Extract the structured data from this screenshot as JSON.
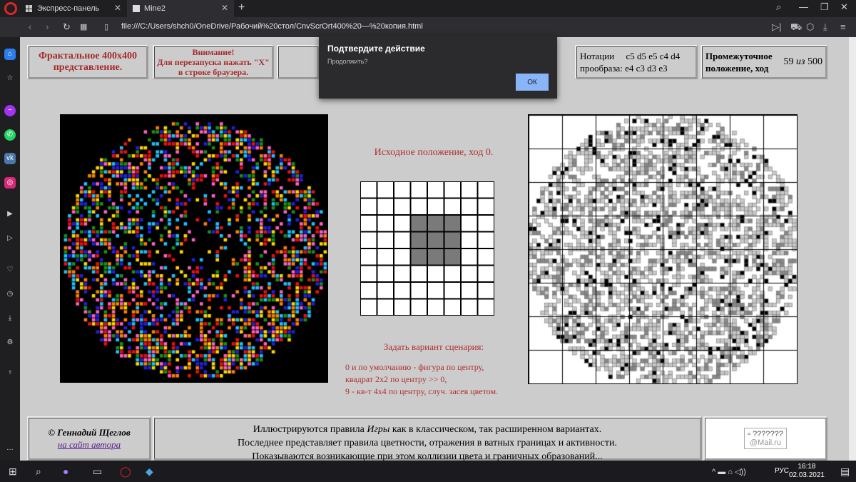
{
  "browser": {
    "tabs": [
      {
        "label": "Экспресс-панель"
      },
      {
        "label": "Mine2"
      }
    ],
    "url": "file:///C:/Users/shch0/OneDrive/Рабочий%20стол/CnvScrOrt400%20—%20копия.html"
  },
  "header": {
    "title_line1": "Фрактальное 400х400",
    "title_line2": "представление.",
    "warning_line1": "Внимание!",
    "warning_line2": "Для перезапуска нажать \"X\"",
    "warning_line3": "в строке браузера.",
    "notation_label1": "Нотации",
    "notation_label2": "прообраза:",
    "notation_row1": "c5 d5 e5 c4 d4",
    "notation_row2": "e4 c3 d3 e3",
    "intermediate_line1": "Промежуточное",
    "intermediate_line2": "положение, ход",
    "move_current": "59",
    "move_of": "из",
    "move_total": "500"
  },
  "dialog": {
    "title": "Подтвердите действие",
    "message": "Продолжить?",
    "ok_label": "ОК"
  },
  "middle": {
    "initial_label": "Исходное положение, ход  0.",
    "scenario_title": "Задать вариант сценария:",
    "scenario_line1": "0 и по умолчанию - фигура по центру,",
    "scenario_line2": "квадрат 2х2  по центру  >> 0,",
    "scenario_line3": "9 - кв-т 4х4 по центру, случ. засев цветом.",
    "grid": {
      "size": 8,
      "filled": [
        [
          3,
          2
        ],
        [
          4,
          2
        ],
        [
          5,
          2
        ],
        [
          3,
          3
        ],
        [
          4,
          3
        ],
        [
          5,
          3
        ],
        [
          3,
          4
        ],
        [
          4,
          4
        ],
        [
          5,
          4
        ]
      ]
    }
  },
  "footer": {
    "author": "© Геннадий Щеглов",
    "author_link": "на сайт автора",
    "line1_a": "Иллюстрируются правила ",
    "line1_em": "Игры",
    "line1_b": " как в классическом, так расширенном вариантах.",
    "line2": "Последнее представляет правила цветности, отражения в ватных границах и активности.",
    "line3": "Показываются возникающие при этом коллизии цвета и граничных образований...",
    "badge_text": "???????",
    "badge_text2": "@Mail.ru"
  },
  "taskbar": {
    "lang": "РУС",
    "time": "16:18",
    "date": "02.03.2021"
  },
  "colors": {
    "title_red": "#a52a2a",
    "link_purple": "#551a8b",
    "dialog_bg": "#2b2b2e",
    "ok_blue": "#8ab4f8",
    "cell_gray": "#7a7a7a"
  }
}
